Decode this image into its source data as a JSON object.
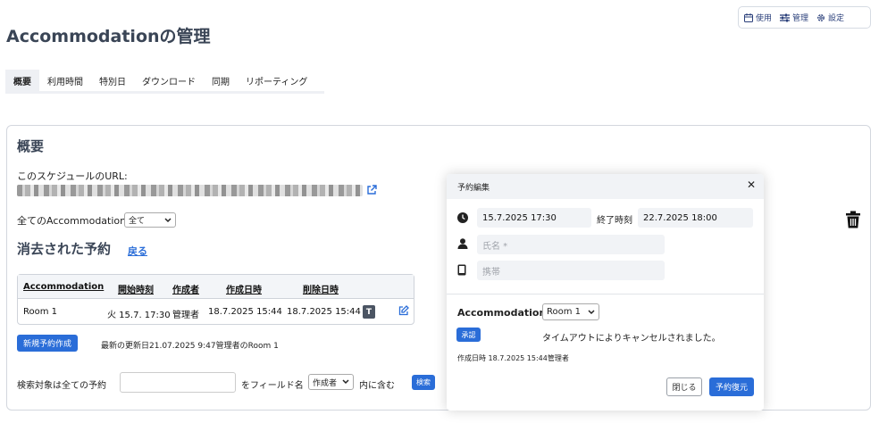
{
  "header": {
    "title": "Accommodationの管理",
    "controls": {
      "use": "使用",
      "manage": "管理",
      "settings": "設定"
    }
  },
  "tabs": [
    "概要",
    "利用時間",
    "特別日",
    "ダウンロード",
    "同期",
    "リポーティング"
  ],
  "overview": {
    "title": "概要",
    "url_label": "このスケジュールのURL:",
    "filter_label": "全てのAccommodation",
    "filter_value": "全て",
    "deleted_title": "消去された予約",
    "back_link": "戻る"
  },
  "table": {
    "headers": [
      "Accommodation",
      "開始時刻",
      "作成者",
      "作成日時",
      "削除日時"
    ],
    "rows": [
      {
        "accommodation": "Room 1",
        "start": "火 15.7. 17:30",
        "creator": "管理者",
        "created": "18.7.2025 15:44",
        "deleted": "18.7.2025 15:44",
        "badge": "T"
      }
    ]
  },
  "actions": {
    "new_button": "新規予約作成",
    "last_update": "最新の更新日21.07.2025 9:47管理者のRoom 1"
  },
  "search": {
    "label": "検索対象は全ての予約",
    "value": "",
    "field_label": "をフィールド名",
    "field_value": "作成者",
    "contains_label": "内に含む",
    "button": "検索"
  },
  "modal": {
    "title": "予約編集",
    "start": "15.7.2025  17:30",
    "end_label": "終了時刻",
    "end": "22.7.2025  18:00",
    "name_placeholder": "氏名 *",
    "phone_placeholder": "携帯",
    "accommodation_label": "Accommodation",
    "accommodation_value": "Room 1",
    "approve_badge": "承認",
    "timeout_text": "タイムアウトによりキャンセルされました。",
    "created_text": "作成日時 18.7.2025 15:44管理者",
    "close_button": "閉じる",
    "restore_button": "予約復元"
  },
  "colors": {
    "accent": "#2a6dd8",
    "title": "#3a4556"
  }
}
